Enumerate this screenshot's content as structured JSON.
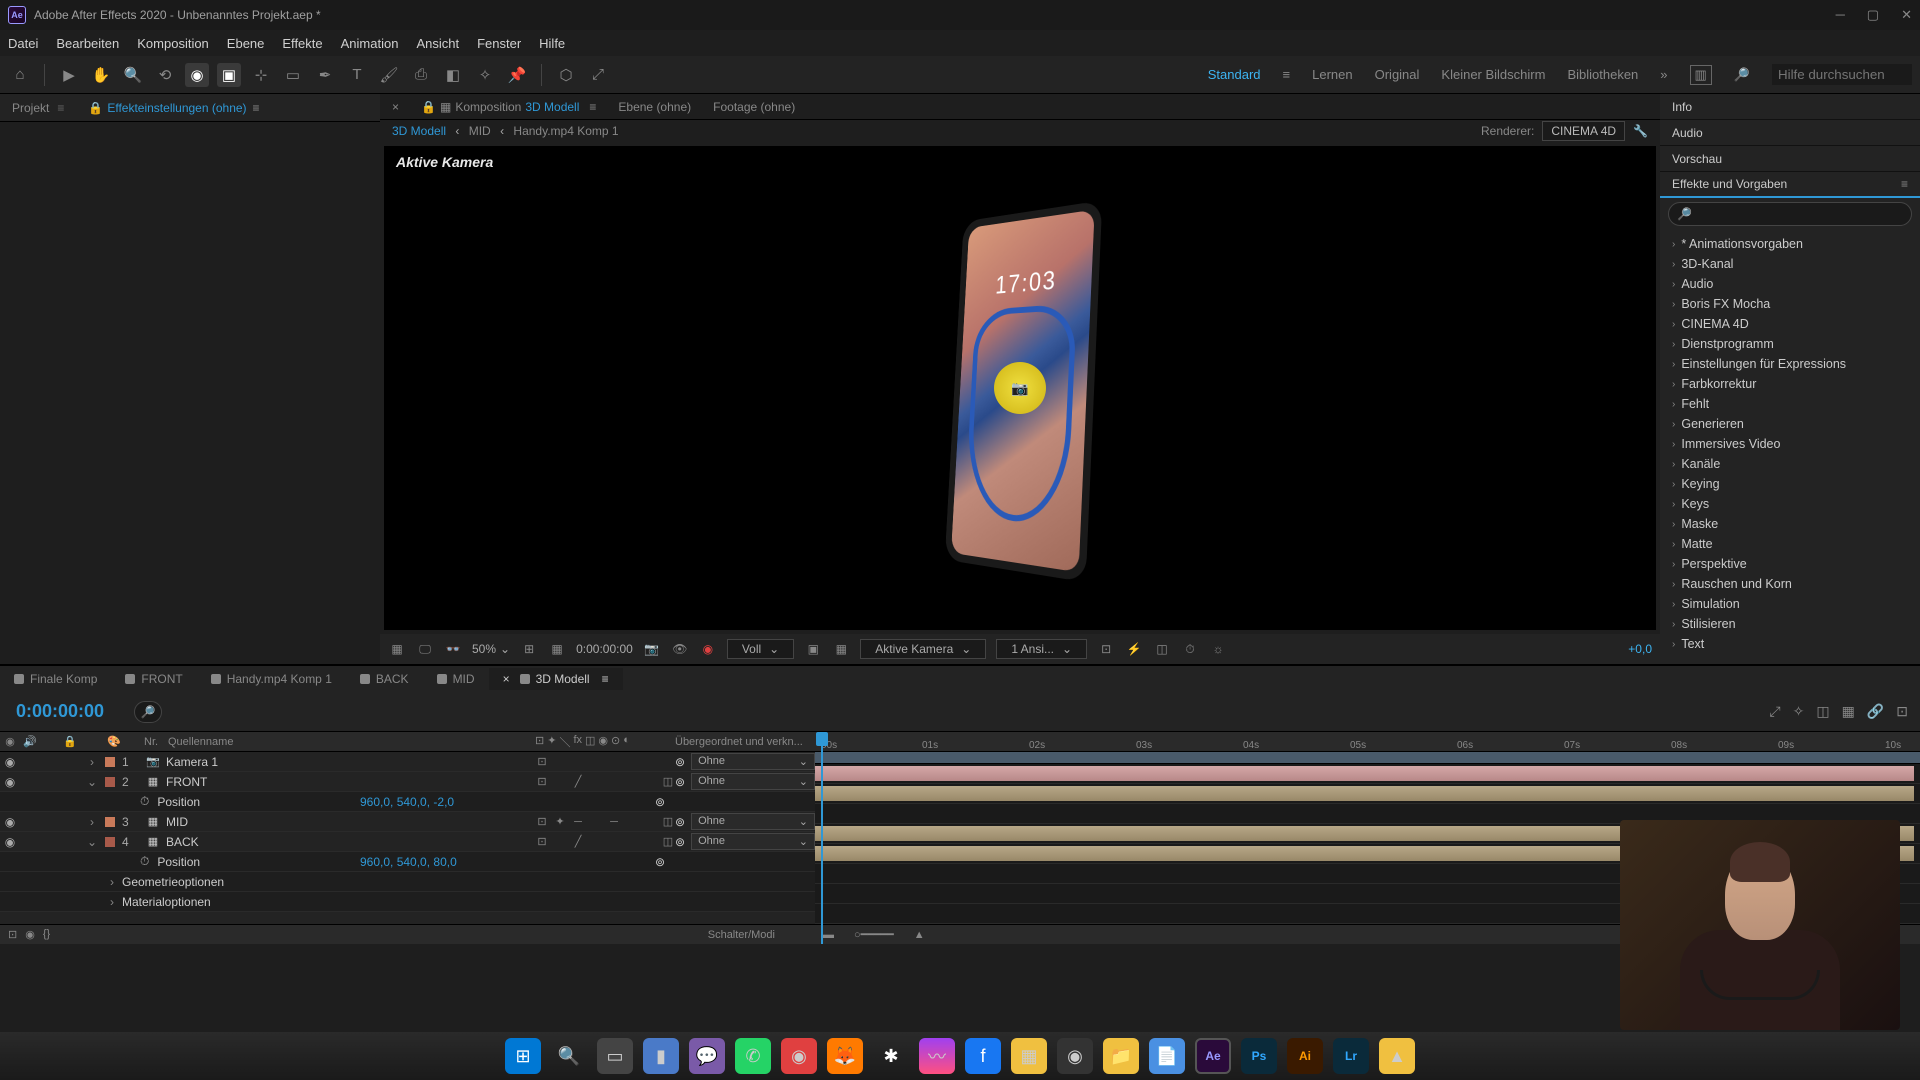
{
  "window": {
    "title": "Adobe After Effects 2020 - Unbenanntes Projekt.aep *",
    "logo": "Ae"
  },
  "menu": [
    "Datei",
    "Bearbeiten",
    "Komposition",
    "Ebene",
    "Effekte",
    "Animation",
    "Ansicht",
    "Fenster",
    "Hilfe"
  ],
  "workspaces": {
    "items": [
      "Standard",
      "Lernen",
      "Original",
      "Kleiner Bildschirm",
      "Bibliotheken"
    ],
    "active": "Standard",
    "search_placeholder": "Hilfe durchsuchen"
  },
  "left_panel": {
    "tab1": "Projekt",
    "tab2": "Effekteinstellungen (ohne)"
  },
  "comp_tabs": {
    "t1": "Komposition",
    "t1b": "3D Modell",
    "t2": "Ebene (ohne)",
    "t3": "Footage (ohne)"
  },
  "breadcrumb": {
    "b1": "3D Modell",
    "b2": "MID",
    "b3": "Handy.mp4 Komp 1",
    "renderer_label": "Renderer:",
    "renderer": "CINEMA 4D"
  },
  "viewport": {
    "camera_label": "Aktive Kamera",
    "phone_time": "17:03"
  },
  "viewer_footer": {
    "zoom": "50%",
    "time": "0:00:00:00",
    "resolution": "Voll",
    "camera": "Aktive Kamera",
    "views": "1 Ansi...",
    "offset": "+0,0"
  },
  "right_panel": {
    "tabs": [
      "Info",
      "Audio",
      "Vorschau"
    ],
    "effects_title": "Effekte und Vorgaben",
    "effects": [
      "* Animationsvorgaben",
      "3D-Kanal",
      "Audio",
      "Boris FX Mocha",
      "CINEMA 4D",
      "Dienstprogramm",
      "Einstellungen für Expressions",
      "Farbkorrektur",
      "Fehlt",
      "Generieren",
      "Immersives Video",
      "Kanäle",
      "Keying",
      "Keys",
      "Maske",
      "Matte",
      "Perspektive",
      "Rauschen und Korn",
      "Simulation",
      "Stilisieren",
      "Text"
    ]
  },
  "timeline": {
    "tabs": [
      "Finale Komp",
      "FRONT",
      "Handy.mp4 Komp 1",
      "BACK",
      "MID",
      "3D Modell"
    ],
    "active_tab": "3D Modell",
    "time": "0:00:00:00",
    "col_headers": {
      "nr": "Nr.",
      "name": "Quellenname",
      "parent": "Übergeordnet und verkn..."
    },
    "layers": [
      {
        "num": "1",
        "name": "Kamera 1",
        "icon": "📷",
        "parent": "Ohne"
      },
      {
        "num": "2",
        "name": "FRONT",
        "icon": "▦",
        "parent": "Ohne",
        "position": "960,0, 540,0, -2,0"
      },
      {
        "num": "3",
        "name": "MID",
        "icon": "▦",
        "parent": "Ohne"
      },
      {
        "num": "4",
        "name": "BACK",
        "icon": "▦",
        "parent": "Ohne",
        "position": "960,0, 540,0, 80,0"
      }
    ],
    "prop_position": "Position",
    "prop_geo": "Geometrieoptionen",
    "prop_mat": "Materialoptionen",
    "footer": "Schalter/Modi",
    "ruler": [
      "00s",
      "01s",
      "02s",
      "03s",
      "04s",
      "05s",
      "06s",
      "07s",
      "08s",
      "09s",
      "10s"
    ]
  }
}
